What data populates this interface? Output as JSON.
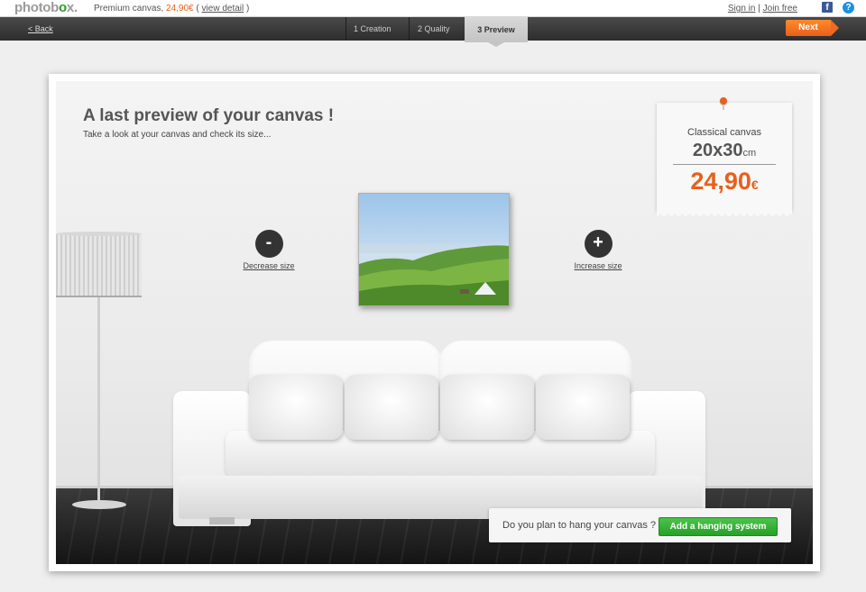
{
  "topbar": {
    "logo": {
      "part1": "photob",
      "o": "o",
      "part2": "x",
      "dot": "."
    },
    "product": "Premium canvas,",
    "price": "24,90€",
    "paren_open": "(",
    "view_detail": "view detail",
    "paren_close": ")",
    "sign_in": "Sign in",
    "separator": "|",
    "join_free": "Join free",
    "facebook_icon": "f",
    "help_icon": "?"
  },
  "nav": {
    "back": "< Back",
    "steps": [
      "1 Creation",
      "2 Quality",
      "3 Preview"
    ],
    "active_step": 3,
    "next": "Next"
  },
  "main": {
    "title": "A last preview of your canvas !",
    "subtitle": "Take a look at your canvas and check its size...",
    "decrease": {
      "symbol": "-",
      "label": "Decrease size"
    },
    "increase": {
      "symbol": "+",
      "label": "Increase size"
    }
  },
  "price_tag": {
    "type": "Classical canvas",
    "size": "20x30",
    "unit": "cm",
    "price": "24,90",
    "currency": "€"
  },
  "hanging": {
    "question": "Do you plan to hang your canvas ?",
    "button": "Add a hanging system"
  },
  "colors": {
    "accent_orange": "#e8601c",
    "button_green": "#28a028",
    "navbar": "#2d2d2d"
  }
}
